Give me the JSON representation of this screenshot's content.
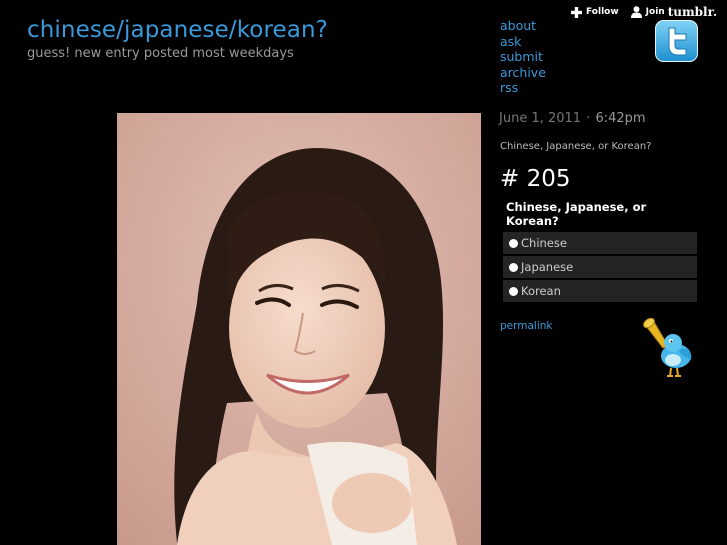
{
  "site": {
    "title": "chinese/japanese/korean?",
    "tagline": "guess! new entry posted most weekdays"
  },
  "nav": {
    "items": [
      {
        "label": "about"
      },
      {
        "label": "ask"
      },
      {
        "label": "submit"
      },
      {
        "label": "archive"
      },
      {
        "label": "rss"
      }
    ]
  },
  "tumblr_bar": {
    "follow_label": "Follow",
    "join_label": "Join",
    "brand": "tumblr."
  },
  "post": {
    "date": "June 1, 2011",
    "separator": "·",
    "time": "6:42pm",
    "caption": "Chinese, Japanese, or Korean?",
    "number": "# 205",
    "permalink_label": "permalink"
  },
  "poll": {
    "question": "Chinese, Japanese, or Korean?",
    "options": [
      {
        "label": "Chinese"
      },
      {
        "label": "Japanese"
      },
      {
        "label": "Korean"
      }
    ]
  },
  "colors": {
    "background": "#000000",
    "link": "#3a9ad9",
    "poll_option_bg": "#242424",
    "twitter_blue": "#2aa9e0"
  },
  "icons": {
    "follow": "plus-icon",
    "join": "person-icon",
    "twitter_badge": "twitter-logo-icon",
    "twitter_bird": "twitter-bird-trumpet-icon"
  }
}
